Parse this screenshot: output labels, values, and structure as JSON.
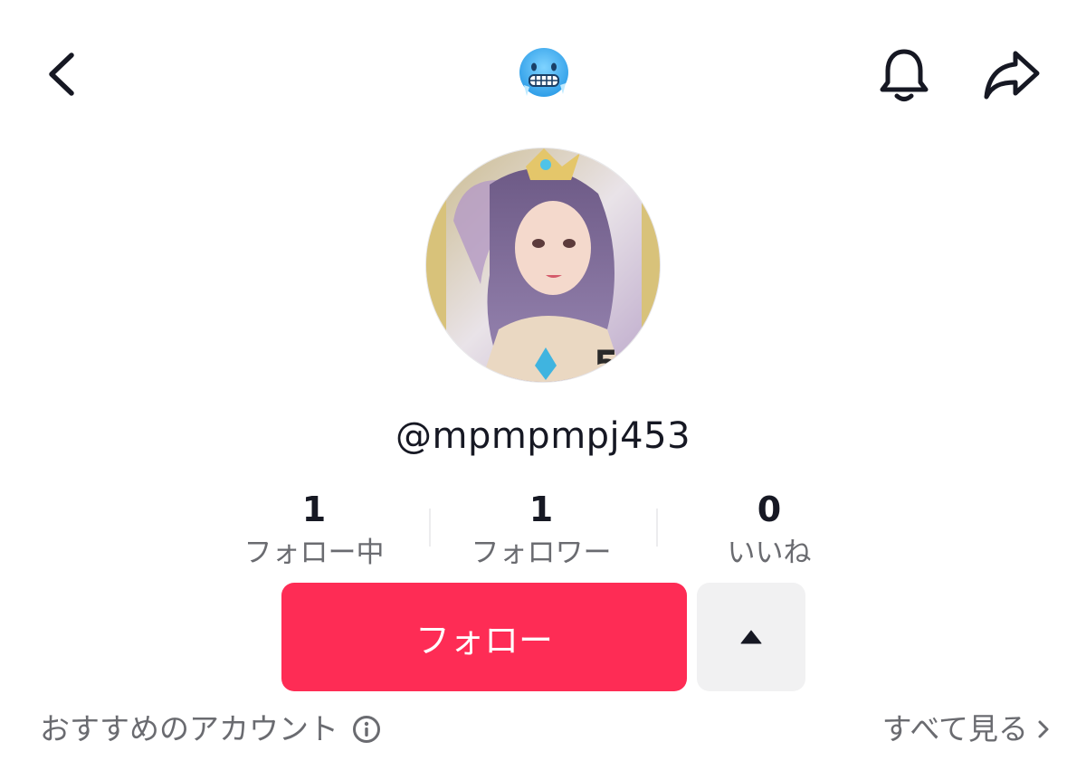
{
  "header": {
    "back_icon": "chevron-left-icon",
    "title_emoji": "cold-face-emoji",
    "notification_icon": "bell-icon",
    "share_icon": "share-arrow-icon"
  },
  "profile": {
    "avatar": "profile-avatar-illustration",
    "username": "@mpmpmpj453"
  },
  "stats": [
    {
      "value": "1",
      "label": "フォロー中"
    },
    {
      "value": "1",
      "label": "フォロワー"
    },
    {
      "value": "0",
      "label": "いいね"
    }
  ],
  "actions": {
    "follow_label": "フォロー",
    "follow_color": "#fe2c55",
    "suggest_icon": "triangle-up-icon"
  },
  "suggested": {
    "label": "おすすめのアカウント",
    "info_icon": "info-icon",
    "see_all_label": "すべて見る",
    "see_all_icon": "chevron-right-icon"
  }
}
